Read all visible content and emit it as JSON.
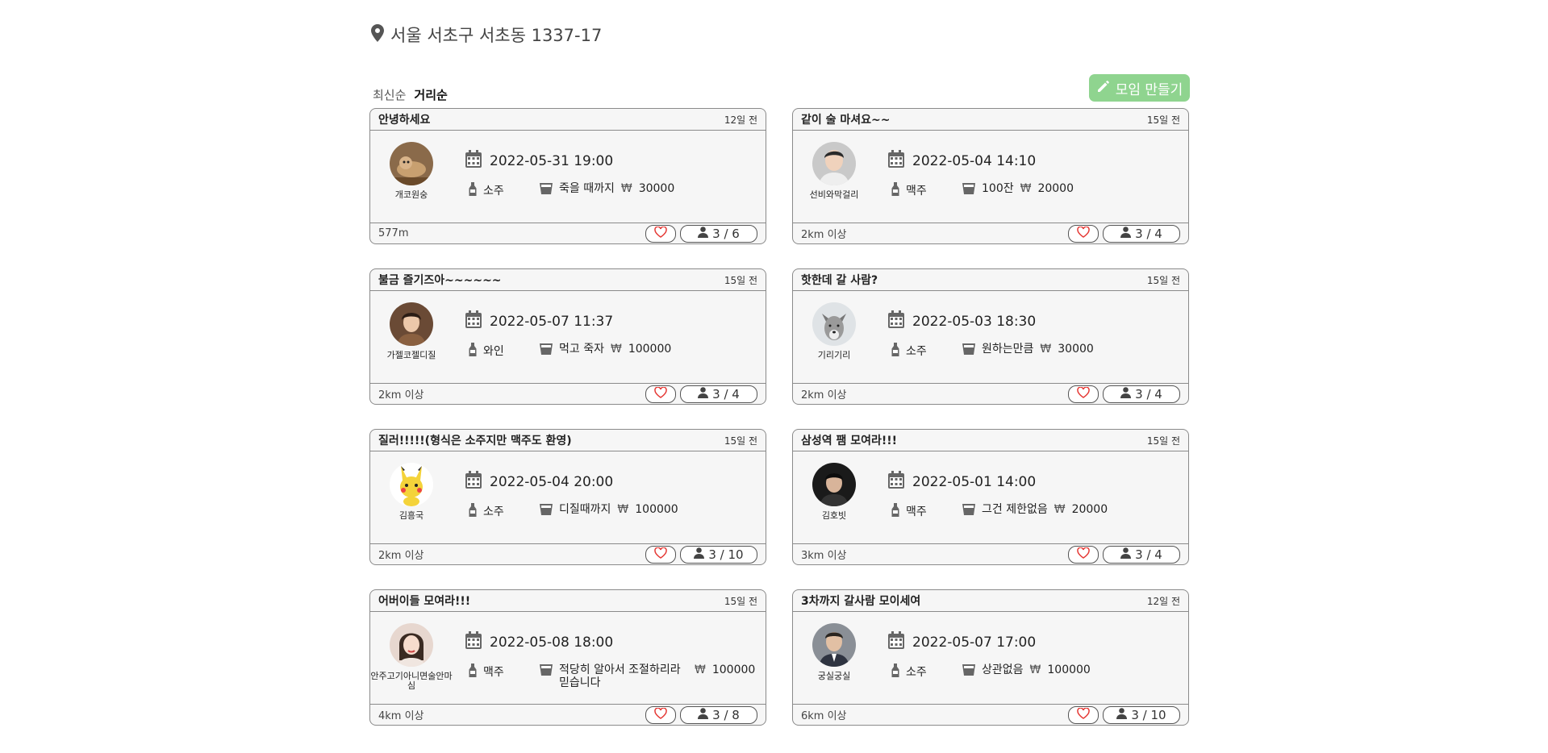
{
  "location": {
    "icon": "map-pin-icon",
    "address": "서울 서초구 서초동 1337-17"
  },
  "sort": {
    "options": [
      {
        "label": "최신순",
        "active": false
      },
      {
        "label": "거리순",
        "active": true
      }
    ]
  },
  "create_button": {
    "icon": "pencil-icon",
    "label": "모임 만들기",
    "color": "#8fd48f"
  },
  "accent_colors": {
    "heart": "#e53935",
    "border": "#8a8a8a",
    "card_bg": "#f6f6f6"
  },
  "cards": [
    {
      "title": "안녕하세요",
      "ago": "12일 전",
      "host": "개코원숭",
      "avatar": "dog",
      "datetime": "2022-05-31 19:00",
      "drink": "소주",
      "amount": "죽을 때까지",
      "price": "30000",
      "distance": "577m",
      "members": "3 / 6"
    },
    {
      "title": "같이 술 마셔요~~",
      "ago": "15일 전",
      "host": "선비와막걸리",
      "avatar": "man1",
      "datetime": "2022-05-04 14:10",
      "drink": "맥주",
      "amount": "100잔",
      "price": "20000",
      "distance": "2km 이상",
      "members": "3 / 4"
    },
    {
      "title": "불금 즐기즈아~~~~~~",
      "ago": "15일 전",
      "host": "가젤코젤디질",
      "avatar": "man2",
      "datetime": "2022-05-07 11:37",
      "drink": "와인",
      "amount": "먹고 죽자",
      "price": "100000",
      "distance": "2km 이상",
      "members": "3 / 4"
    },
    {
      "title": "핫한데 갈 사람?",
      "ago": "15일 전",
      "host": "기리기리",
      "avatar": "wolf",
      "datetime": "2022-05-03 18:30",
      "drink": "소주",
      "amount": "원하는만큼",
      "price": "30000",
      "distance": "2km 이상",
      "members": "3 / 4"
    },
    {
      "title": "질러!!!!!(형식은 소주지만 맥주도 환영)",
      "ago": "15일 전",
      "host": "김흥국",
      "avatar": "pikachu",
      "datetime": "2022-05-04 20:00",
      "drink": "소주",
      "amount": "디질때까지",
      "price": "100000",
      "distance": "2km 이상",
      "members": "3 / 10"
    },
    {
      "title": "삼성역 팸 모여라!!!",
      "ago": "15일 전",
      "host": "김호빗",
      "avatar": "man3",
      "datetime": "2022-05-01 14:00",
      "drink": "맥주",
      "amount": "그건 제한없음",
      "price": "20000",
      "distance": "3km 이상",
      "members": "3 / 4"
    },
    {
      "title": "어버이들 모여라!!!",
      "ago": "15일 전",
      "host": "안주고기아니면술안마심",
      "avatar": "woman",
      "datetime": "2022-05-08 18:00",
      "drink": "맥주",
      "amount": "적당히 알아서 조절하리라 믿습니다",
      "price": "100000",
      "distance": "4km 이상",
      "members": "3 / 8"
    },
    {
      "title": "3차까지 갈사람 모이세여",
      "ago": "12일 전",
      "host": "궁실궁실",
      "avatar": "man4",
      "datetime": "2022-05-07 17:00",
      "drink": "소주",
      "amount": "상관없음",
      "price": "100000",
      "distance": "6km 이상",
      "members": "3 / 10"
    }
  ]
}
